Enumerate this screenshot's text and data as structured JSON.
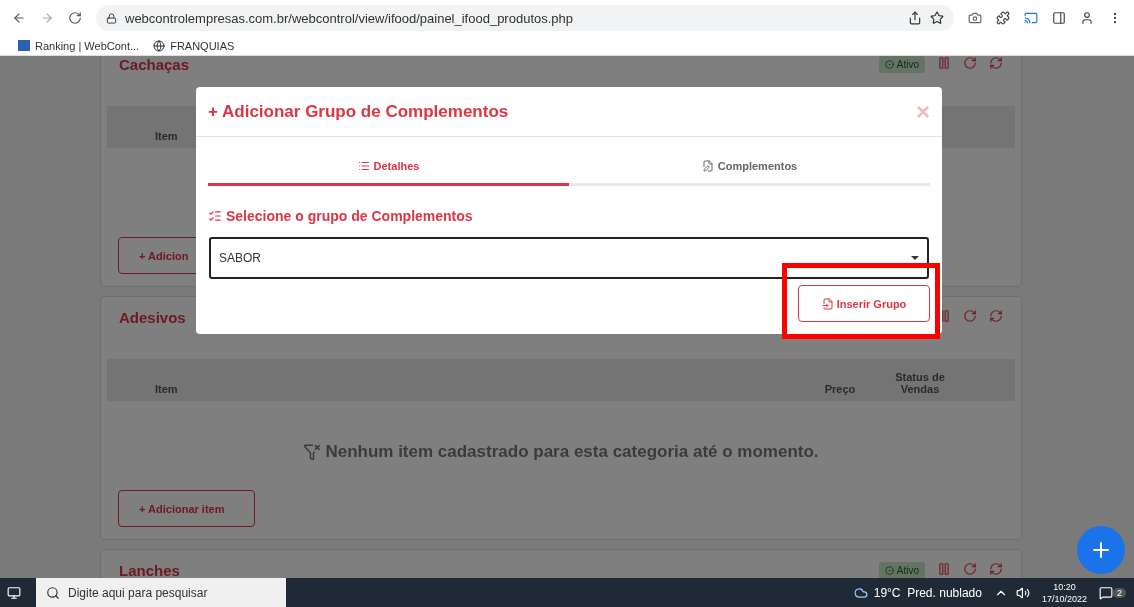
{
  "browser": {
    "url": "webcontrolempresas.com.br/webcontrol/view/ifood/painel_ifood_produtos.php",
    "bookmarks": [
      {
        "label": "Ranking | WebCont...",
        "kind": "logo"
      },
      {
        "label": "FRANQUIAS",
        "kind": "globe"
      }
    ]
  },
  "cards": [
    {
      "title": "Cachaças",
      "status": "Ativo",
      "columns": [
        "Item"
      ],
      "add_button": "+ Adicion"
    },
    {
      "title": "Adesivos",
      "columns": [
        "Item",
        "Preço",
        "Status de Vendas"
      ],
      "empty_message": "Nenhum item cadastrado para esta categoria até o momento.",
      "add_button": "+ Adicionar item"
    },
    {
      "title": "Lanches",
      "status": "Ativo"
    }
  ],
  "modal": {
    "title": "+ Adicionar Grupo de Complementos",
    "close": "×",
    "tabs": [
      {
        "label": "Detalhes",
        "selected": true,
        "kind": "list"
      },
      {
        "label": "Complementos",
        "selected": false,
        "kind": "edit"
      }
    ],
    "section_title": "Selecione o grupo de Complementos",
    "select_value": "SABOR",
    "button": "Inserir Grupo",
    "highlighted": true
  },
  "taskbar": {
    "search_placeholder": "Digite aqui para pesquisar",
    "weather": "19°C  Pred. nublado",
    "time": "10:20",
    "date": "17/10/2022",
    "notifications": "2"
  }
}
